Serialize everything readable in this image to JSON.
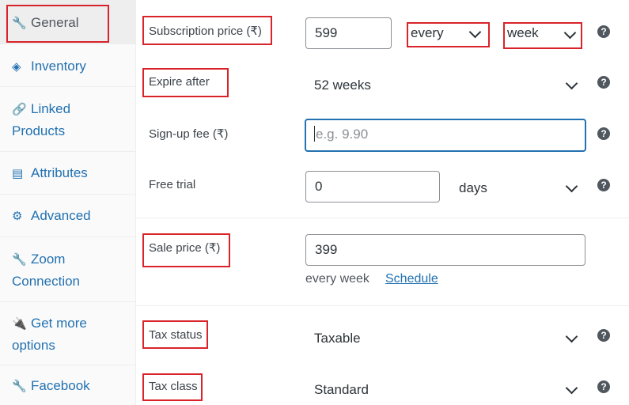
{
  "sidebar": {
    "items": [
      {
        "label": "General",
        "icon": "wrench-icon",
        "glyph": "🔧",
        "active": true
      },
      {
        "label": "Inventory",
        "icon": "tag-icon",
        "glyph": "◈"
      },
      {
        "label_line1": "Linked",
        "label_line2": "Products",
        "icon": "link-icon",
        "glyph": "🔗"
      },
      {
        "label": "Attributes",
        "icon": "list-icon",
        "glyph": "▤"
      },
      {
        "label": "Advanced",
        "icon": "gear-icon",
        "glyph": "⚙"
      },
      {
        "label_line1": "Zoom",
        "label_line2": "Connection",
        "icon": "wrench-icon",
        "glyph": "🔧"
      },
      {
        "label_line1": "Get more",
        "label_line2": "options",
        "icon": "plug-icon",
        "glyph": "🔌"
      },
      {
        "label": "Facebook",
        "icon": "wrench-icon",
        "glyph": "🔧"
      }
    ]
  },
  "fields": {
    "subscription_price": {
      "label": "Subscription price (₹)",
      "value": "599",
      "interval": "every",
      "period": "week"
    },
    "expire_after": {
      "label": "Expire after",
      "value": "52 weeks"
    },
    "signup_fee": {
      "label": "Sign-up fee (₹)",
      "placeholder": "e.g. 9.90"
    },
    "free_trial": {
      "label": "Free trial",
      "value": "0",
      "unit": "days"
    },
    "sale_price": {
      "label": "Sale price (₹)",
      "value": "399",
      "description": "every week",
      "schedule_link": "Schedule"
    },
    "tax_status": {
      "label": "Tax status",
      "value": "Taxable"
    },
    "tax_class": {
      "label": "Tax class",
      "value": "Standard"
    }
  },
  "help_glyph": "?",
  "colors": {
    "accent": "#2271b1",
    "highlight": "#d9232a",
    "text": "#3c434a"
  }
}
